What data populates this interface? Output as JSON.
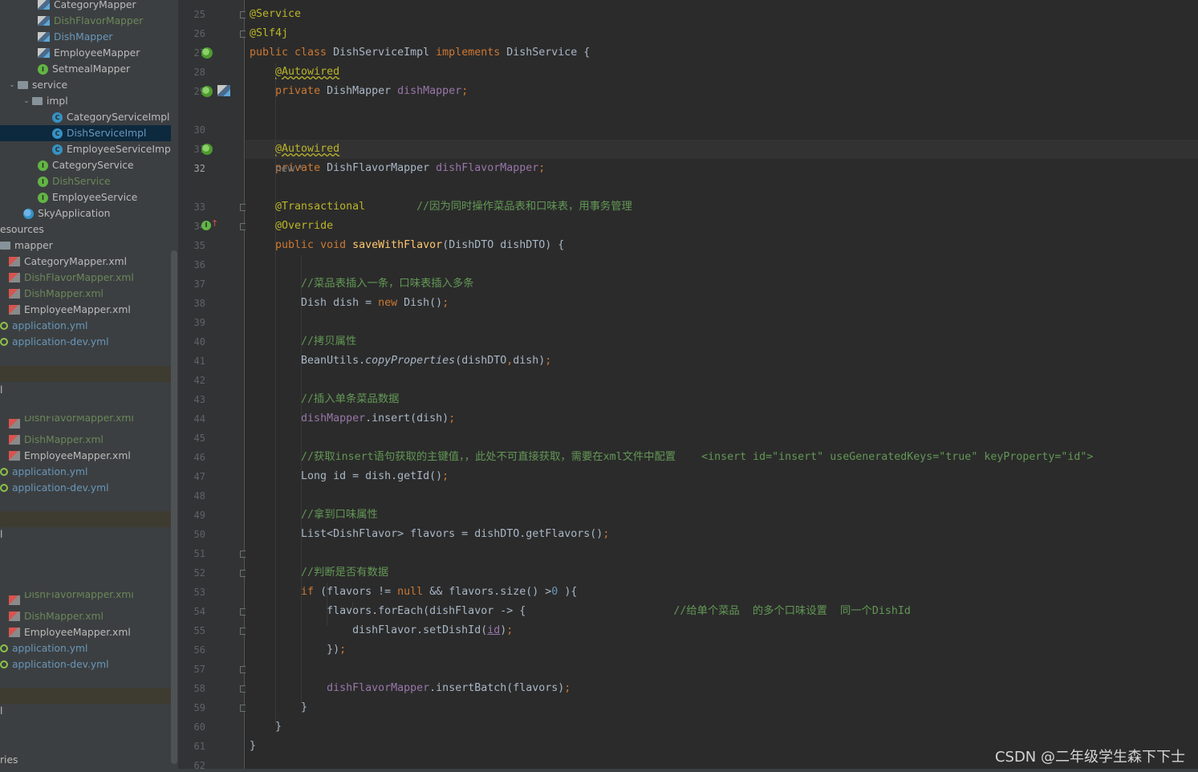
{
  "sidebar": {
    "rows": [
      {
        "label": "CategoryMapper",
        "icon": "mapper-icon",
        "color": "#bbbbbb",
        "indent": 47
      },
      {
        "label": "DishFlavorMapper",
        "icon": "mapper-icon",
        "color": "#6a8759",
        "indent": 47
      },
      {
        "label": "DishMapper",
        "icon": "mapper-icon",
        "color": "#6897bb",
        "indent": 47
      },
      {
        "label": "EmployeeMapper",
        "icon": "mapper-icon",
        "color": "#bbbbbb",
        "indent": 47
      },
      {
        "label": "SetmealMapper",
        "icon": "interface-icon",
        "color": "#bbbbbb",
        "indent": 47
      },
      {
        "label": "service",
        "icon": "folder-icon",
        "color": "#bbbbbb",
        "indent": 11,
        "arrow": "v"
      },
      {
        "label": "impl",
        "icon": "folder-icon",
        "color": "#bbbbbb",
        "indent": 29,
        "arrow": "v"
      },
      {
        "label": "CategoryServiceImpl",
        "icon": "class-icon",
        "color": "#bbbbbb",
        "indent": 65
      },
      {
        "label": "DishServiceImpl",
        "icon": "class-icon",
        "color": "#6897bb",
        "indent": 65,
        "selected": true
      },
      {
        "label": "EmployeeServiceImpl",
        "icon": "class-icon",
        "color": "#bbbbbb",
        "indent": 65
      },
      {
        "label": "CategoryService",
        "icon": "interface-icon",
        "color": "#bbbbbb",
        "indent": 47
      },
      {
        "label": "DishService",
        "icon": "interface-icon",
        "color": "#6a8759",
        "indent": 47
      },
      {
        "label": "EmployeeService",
        "icon": "interface-icon",
        "color": "#bbbbbb",
        "indent": 47
      },
      {
        "label": "SkyApplication",
        "icon": "run-class-icon",
        "color": "#bbbbbb",
        "indent": 29
      },
      {
        "label": "esources",
        "icon": "",
        "color": "#bbbbbb",
        "indent": 0
      },
      {
        "label": "mapper",
        "icon": "folder-icon",
        "color": "#bbbbbb",
        "indent": 0
      },
      {
        "label": "CategoryMapper.xml",
        "icon": "xml-icon",
        "color": "#bbbbbb",
        "indent": 11
      },
      {
        "label": "DishFlavorMapper.xml",
        "icon": "xml-icon",
        "color": "#6a8759",
        "indent": 11
      },
      {
        "label": "DishMapper.xml",
        "icon": "xml-icon",
        "color": "#6a8759",
        "indent": 11
      },
      {
        "label": "EmployeeMapper.xml",
        "icon": "xml-icon",
        "color": "#bbbbbb",
        "indent": 11
      },
      {
        "label": "application.yml",
        "icon": "yml-icon",
        "color": "#6897bb",
        "indent": 0
      },
      {
        "label": "application-dev.yml",
        "icon": "yml-icon",
        "color": "#6897bb",
        "indent": 0
      },
      {
        "label": "",
        "band": true
      },
      {
        "label": "l",
        "color": "#bbbbbb",
        "indent": 0
      },
      {
        "label": "DishFlavorMapper.xml",
        "icon": "xml-icon",
        "color": "#6a8759",
        "indent": 11,
        "clip": true
      },
      {
        "label": "DishMapper.xml",
        "icon": "xml-icon",
        "color": "#6a8759",
        "indent": 11
      },
      {
        "label": "EmployeeMapper.xml",
        "icon": "xml-icon",
        "color": "#bbbbbb",
        "indent": 11
      },
      {
        "label": "application.yml",
        "icon": "yml-icon",
        "color": "#6897bb",
        "indent": 0
      },
      {
        "label": "application-dev.yml",
        "icon": "yml-icon",
        "color": "#6897bb",
        "indent": 0
      },
      {
        "label": "",
        "band": true
      },
      {
        "label": "l",
        "color": "#bbbbbb",
        "indent": 0
      },
      {
        "label": "DishFlavorMapper.xml",
        "icon": "xml-icon",
        "color": "#6a8759",
        "indent": 11,
        "clip": true
      },
      {
        "label": "DishMapper.xml",
        "icon": "xml-icon",
        "color": "#6a8759",
        "indent": 11
      },
      {
        "label": "EmployeeMapper.xml",
        "icon": "xml-icon",
        "color": "#bbbbbb",
        "indent": 11
      },
      {
        "label": "application.yml",
        "icon": "yml-icon",
        "color": "#6897bb",
        "indent": 0
      },
      {
        "label": "application-dev.yml",
        "icon": "yml-icon",
        "color": "#6897bb",
        "indent": 0
      },
      {
        "label": "",
        "band": true
      },
      {
        "label": "l",
        "color": "#bbbbbb",
        "indent": 0
      },
      {
        "label": "ries",
        "color": "#bbbbbb",
        "indent": 0
      }
    ]
  },
  "editor": {
    "lines": [
      {
        "n": "25",
        "html": "<span class='an'>@Service</span>"
      },
      {
        "n": "26",
        "html": "<span class='an'>@Slf4j</span>"
      },
      {
        "n": "27",
        "html": "<span class='kw'>public class </span>DishServiceImpl <span class='kw'>implements </span>DishService {"
      },
      {
        "n": "28",
        "html": ""
      },
      {
        "n": "29",
        "html": "    <span class='an wv'>@Autowired</span>"
      },
      {
        "n": "",
        "html": ""
      },
      {
        "n": "30",
        "html": ""
      },
      {
        "n": "31",
        "html": "    <span class='an wv'>@Autowired</span>"
      },
      {
        "n": "32",
        "html": "    <span class='kw'>private </span>DishFlavorMapper <span class='fd'>dishFlavorMapper</span><span class='kw'>;</span>"
      },
      {
        "n": "",
        "html": ""
      },
      {
        "n": "33",
        "html": "    <span class='an'>@Transactional</span>        <span class='cm'>//因为同时操作菜品表和口味表，用事务管理</span>"
      },
      {
        "n": "34",
        "html": "    <span class='an'>@Override</span>"
      },
      {
        "n": "35",
        "html": "    <span class='kw'>public void </span><span class='mt'>saveWithFlavor</span>(DishDTO dishDTO) {"
      },
      {
        "n": "36",
        "html": ""
      },
      {
        "n": "37",
        "html": "        <span class='cm'>//菜品表插入一条，口味表插入多条</span>"
      },
      {
        "n": "38",
        "html": "        Dish dish = <span class='kw'>new </span>Dish()<span class='kw'>;</span>"
      },
      {
        "n": "39",
        "html": ""
      },
      {
        "n": "40",
        "html": "        <span class='cm'>//拷贝属性</span>"
      },
      {
        "n": "41",
        "html": "        BeanUtils.<span class='it'>copyProperties</span>(dishDTO<span class='kw'>,</span>dish)<span class='kw'>;</span>"
      },
      {
        "n": "42",
        "html": ""
      },
      {
        "n": "43",
        "html": "        <span class='cm'>//插入单条菜品数据</span>"
      },
      {
        "n": "44",
        "html": "        <span class='fd'>dishMapper</span>.insert(dish)<span class='kw'>;</span>"
      },
      {
        "n": "45",
        "html": ""
      },
      {
        "n": "46",
        "html": "        <span class='cm'>//获取insert语句获取的主键值，，此处不可直接获取，需要在xml文件中配置    &lt;insert id=\"insert\" useGeneratedKeys=\"true\" keyProperty=\"id\"&gt;</span>"
      },
      {
        "n": "47",
        "html": "        Long id = dish.getId()<span class='kw'>;</span>"
      },
      {
        "n": "48",
        "html": ""
      },
      {
        "n": "49",
        "html": "        <span class='cm'>//拿到口味属性</span>"
      },
      {
        "n": "50",
        "html": "        List&lt;DishFlavor&gt; flavors = dishDTO.getFlavors()<span class='kw'>;</span>"
      },
      {
        "n": "51",
        "html": ""
      },
      {
        "n": "52",
        "html": "        <span class='cm'>//判断是否有数据</span>"
      },
      {
        "n": "53",
        "html": "        <span class='kw'>if </span>(flavors != <span class='kw'>null </span>&amp;&amp; flavors.size() &gt;<span class='num'>0</span> ){"
      },
      {
        "n": "54",
        "html": "            flavors.forEach(dishFlavor -&gt; {                       <span class='cm'>//给单个菜品  的多个口味设置  同一个DishId</span>"
      },
      {
        "n": "55",
        "html": "                dishFlavor.setDishId(<span class='fd ul'>id</span>)<span class='kw'>;</span>"
      },
      {
        "n": "56",
        "html": "            })<span class='kw'>;</span>"
      },
      {
        "n": "57",
        "html": ""
      },
      {
        "n": "58",
        "html": "            <span class='fd'>dishFlavorMapper</span>.insertBatch(flavors)<span class='kw'>;</span>"
      },
      {
        "n": "59",
        "html": "        }"
      },
      {
        "n": "60",
        "html": "    }"
      },
      {
        "n": "61",
        "html": "}"
      },
      {
        "n": "62",
        "html": ""
      }
    ],
    "line29b": "    <span class='kw'>private </span>DishMapper <span class='fd'>dishMapper</span><span class='kw'>;</span>",
    "hint": "new *"
  },
  "watermark": "CSDN @二年级学生森下下士"
}
